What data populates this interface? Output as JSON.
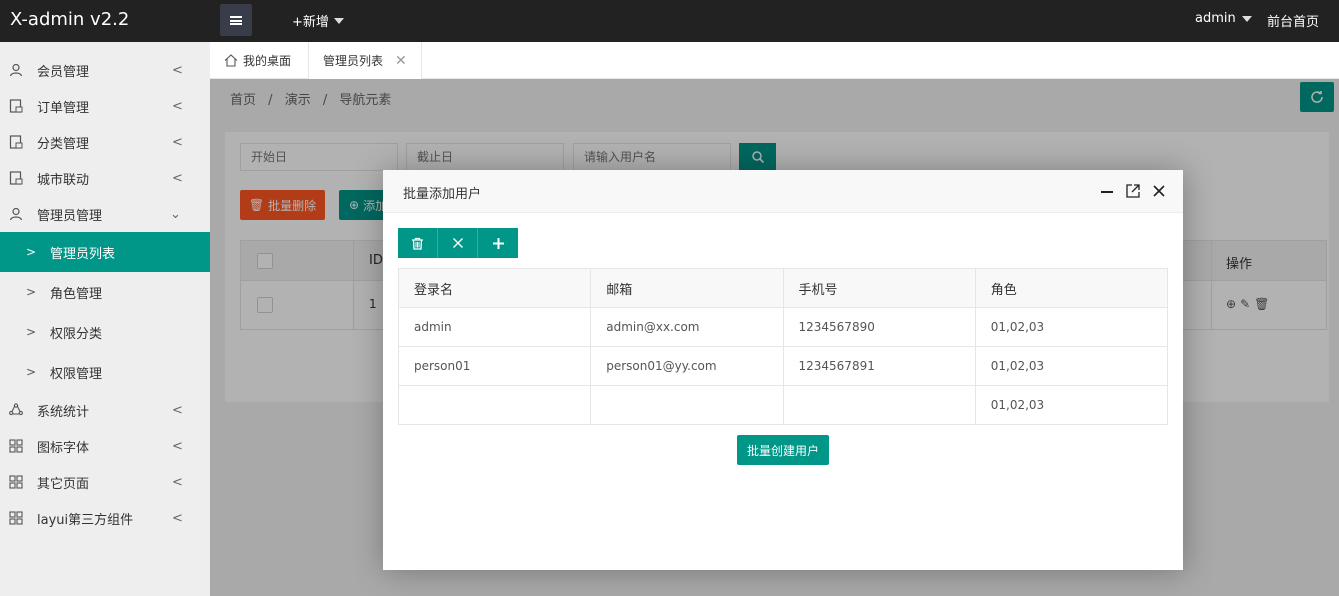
{
  "app": {
    "title": "X-admin v2.2"
  },
  "topbar": {
    "add_new": "+新增",
    "user": "admin",
    "home_link": "前台首页"
  },
  "sidebar": {
    "items": [
      {
        "label": "会员管理",
        "icon": "user-icon"
      },
      {
        "label": "订单管理",
        "icon": "order-icon"
      },
      {
        "label": "分类管理",
        "icon": "category-icon"
      },
      {
        "label": "城市联动",
        "icon": "city-icon"
      },
      {
        "label": "管理员管理",
        "icon": "admin-icon"
      },
      {
        "label": "系统统计",
        "icon": "stats-icon"
      },
      {
        "label": "图标字体",
        "icon": "grid-icon"
      },
      {
        "label": "其它页面",
        "icon": "grid-icon"
      },
      {
        "label": "layui第三方组件",
        "icon": "grid-icon"
      }
    ],
    "subitems": [
      {
        "label": "管理员列表",
        "active": true
      },
      {
        "label": "角色管理",
        "active": false
      },
      {
        "label": "权限分类",
        "active": false
      },
      {
        "label": "权限管理",
        "active": false
      }
    ]
  },
  "tabs": {
    "home": "我的桌面",
    "active": "管理员列表"
  },
  "breadcrumb": {
    "items": [
      "首页",
      "演示",
      "导航元素"
    ],
    "sep": "/"
  },
  "filters": {
    "start": "开始日",
    "end": "截止日",
    "username": "请输入用户名"
  },
  "actions": {
    "batch_delete": "批量删除",
    "add": "添加"
  },
  "bg_table": {
    "id_header": "ID",
    "op_header": "操作",
    "first_id": "1"
  },
  "modal": {
    "title": "批量添加用户",
    "columns": [
      "登录名",
      "邮箱",
      "手机号",
      "角色"
    ],
    "rows": [
      [
        "admin",
        "admin@xx.com",
        "1234567890",
        "01,02,03"
      ],
      [
        "person01",
        "person01@yy.com",
        "1234567891",
        "01,02,03"
      ],
      [
        "",
        "",
        "",
        "01,02,03"
      ]
    ],
    "submit": "批量创建用户"
  },
  "colors": {
    "primary": "#009688",
    "danger": "#FF5722",
    "topbar": "#222222"
  }
}
